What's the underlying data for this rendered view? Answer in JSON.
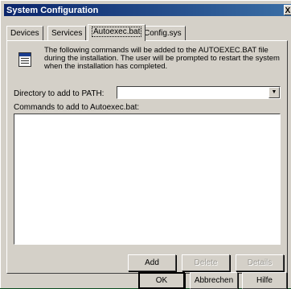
{
  "window": {
    "title": "System Configuration",
    "close_glyph": "X"
  },
  "tabs": [
    {
      "label": "Devices",
      "active": false
    },
    {
      "label": "Services",
      "active": false
    },
    {
      "label": "Autoexec.bat",
      "active": true
    },
    {
      "label": "Config.sys",
      "active": false
    }
  ],
  "panel": {
    "icon": "document-info-icon",
    "info_text": "The following commands will be added to the AUTOEXEC.BAT file during the installation. The user will be prompted to restart the system when the installation has completed.",
    "path_label": "Directory to add to PATH:",
    "path_value": "",
    "commands_label": "Commands to add to Autoexec.bat:",
    "commands": []
  },
  "panel_buttons": {
    "add": "Add",
    "delete": "Delete",
    "details": "Details"
  },
  "dialog_buttons": {
    "ok": "OK",
    "cancel": "Abbrechen",
    "help": "Hilfe"
  },
  "colors": {
    "titlebar": "#0a246a",
    "face": "#d4d0c8",
    "desktop": "#0a4a1e"
  }
}
